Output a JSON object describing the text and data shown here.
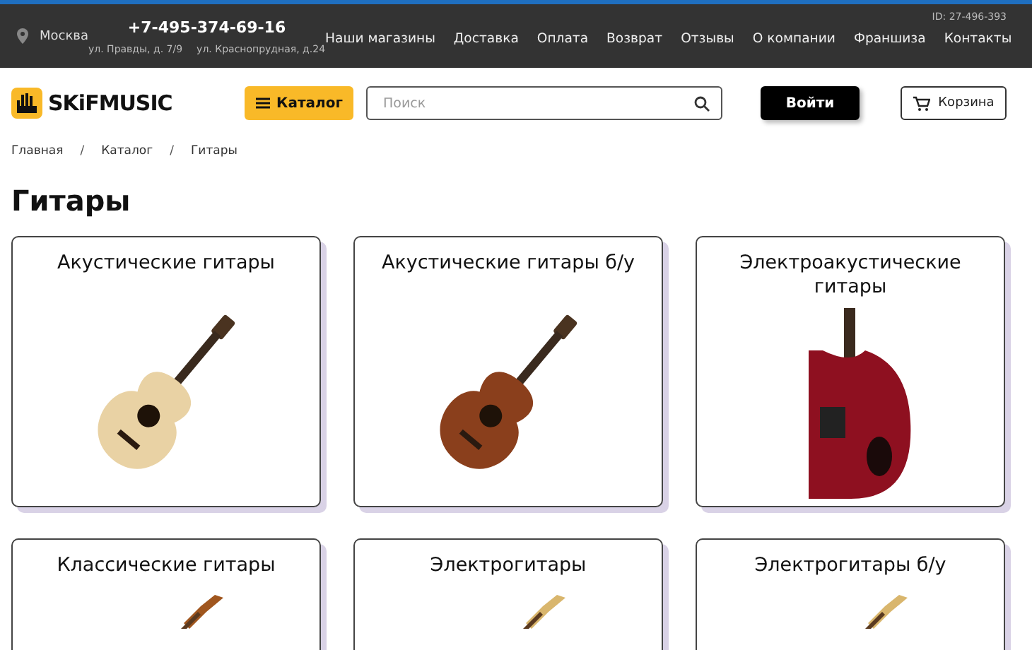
{
  "topbar": {
    "city": "Москва",
    "phone": "+7-495-374-69-16",
    "addresses": [
      "ул. Правды, д. 7/9",
      "ул. Краснопрудная, д.24"
    ],
    "id": "ID: 27-496-393",
    "links": [
      "Наши магазины",
      "Доставка",
      "Оплата",
      "Возврат",
      "Отзывы",
      "О компании",
      "Франшиза",
      "Контакты"
    ]
  },
  "header": {
    "logo": "SKiFMUSIC",
    "catalog_button": "Каталог",
    "search": {
      "placeholder": "Поиск"
    },
    "login_button": "Войти",
    "cart_button": "Корзина"
  },
  "breadcrumbs": [
    {
      "label": "Главная"
    },
    {
      "separator": "/",
      "label": "Каталог"
    },
    {
      "separator": "/",
      "label": "Гитары"
    }
  ],
  "title": "Гитары",
  "categories": [
    {
      "name": "Акустические гитары",
      "kind": "acoustic"
    },
    {
      "name": "Акустические гитары б/у",
      "kind": "acoustic-dark"
    },
    {
      "name": "Электроакустические гитары",
      "kind": "electroacoustic"
    },
    {
      "name": "Классические гитары",
      "kind": "classical"
    },
    {
      "name": "Электрогитары",
      "kind": "electric"
    },
    {
      "name": "Электрогитары б/у",
      "kind": "electric"
    }
  ]
}
